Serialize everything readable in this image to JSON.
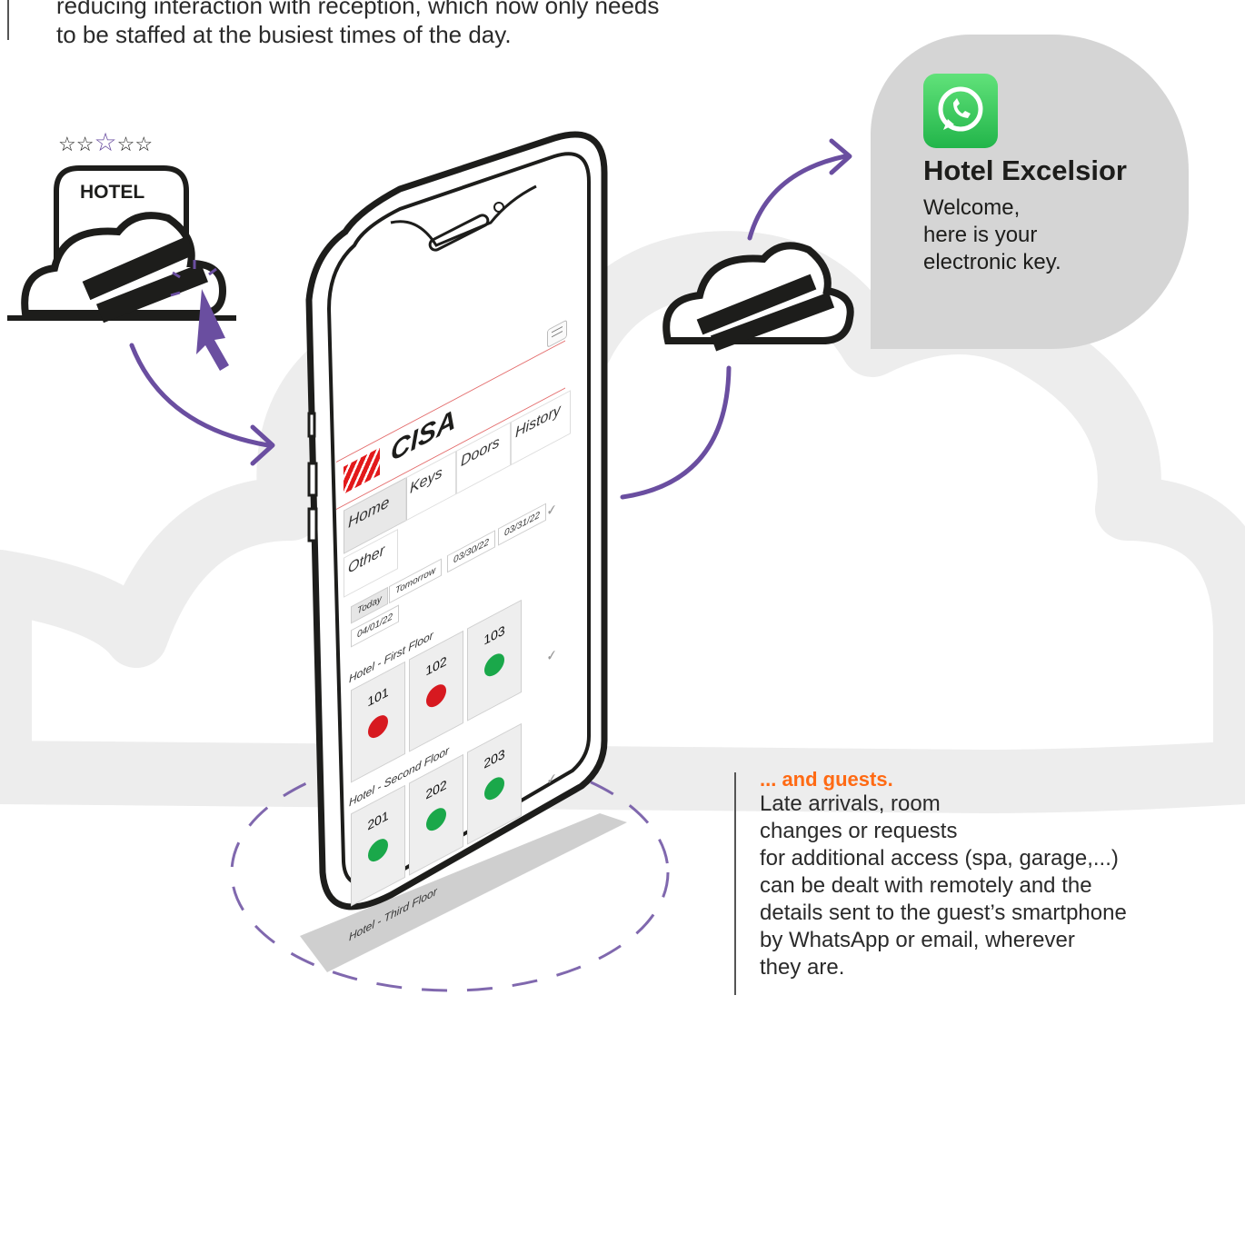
{
  "intro": {
    "line1": "reducing interaction with reception, which now only needs",
    "line2": "to be staffed at the busiest times of the day."
  },
  "hotel_sign": {
    "label": "HOTEL",
    "stars_text": "☆☆☆☆☆"
  },
  "whatsapp": {
    "title": "Hotel Excelsior",
    "line1": "Welcome,",
    "line2": "here is your",
    "line3": "electronic key."
  },
  "guests": {
    "title": "... and guests.",
    "lines": [
      "Late arrivals, room",
      "changes or requests",
      "for additional access (spa, garage,...)",
      "can be dealt with remotely and the",
      "details sent to the guest’s smartphone",
      "by WhatsApp or email, wherever",
      "they are."
    ]
  },
  "app": {
    "brand": "CISA",
    "tabs": {
      "home": "Home",
      "keys": "Keys",
      "doors": "Doors",
      "history": "History",
      "other": "Other"
    },
    "dates": [
      "Today",
      "Tomorrow",
      "03/30/22",
      "03/31/22",
      "04/01/22"
    ],
    "floors": [
      {
        "name": "Hotel - First Floor",
        "rooms": [
          "101",
          "102",
          "103"
        ]
      },
      {
        "name": "Hotel - Second Floor",
        "rooms": [
          "201",
          "202",
          "203"
        ]
      },
      {
        "name": "Hotel - Third Floor",
        "rooms": []
      }
    ]
  },
  "colors": {
    "accent_purple": "#6a4ea0",
    "accent_orange": "#ff6a13",
    "cisa_red": "#e3191b",
    "status_occupied": "#d71920",
    "status_free": "#1aa84a"
  },
  "icons": [
    "star-icon",
    "cloud-icon",
    "cursor-icon",
    "whatsapp-icon",
    "bed-icon",
    "suitcase-icon",
    "menu-icon",
    "chevron-down-icon"
  ]
}
